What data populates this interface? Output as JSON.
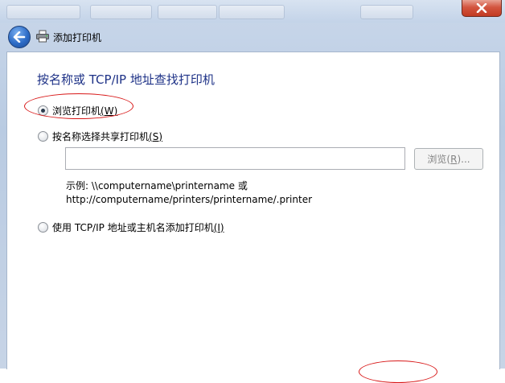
{
  "window": {
    "title": "添加打印机",
    "close_icon": "close-icon"
  },
  "heading": "按名称或 TCP/IP 地址查找打印机",
  "options": {
    "browse": {
      "label": "浏览打印机",
      "key": "(W)",
      "checked": true
    },
    "shared": {
      "label": "按名称选择共享打印机",
      "key": "(S)",
      "checked": false
    },
    "tcpip": {
      "label": "使用 TCP/IP 地址或主机名添加打印机",
      "key": "(I)",
      "checked": false
    }
  },
  "shared_name_input": {
    "value": "",
    "placeholder": ""
  },
  "browse_button": {
    "label_prefix": "浏览(",
    "key": "R",
    "label_suffix": ")..."
  },
  "example": {
    "line1": "示例: \\\\computername\\printername 或",
    "line2": "http://computername/printers/printername/.printer"
  },
  "colors": {
    "heading": "#1e3287",
    "annotation": "#d81818",
    "close_button": "#c23b22"
  }
}
